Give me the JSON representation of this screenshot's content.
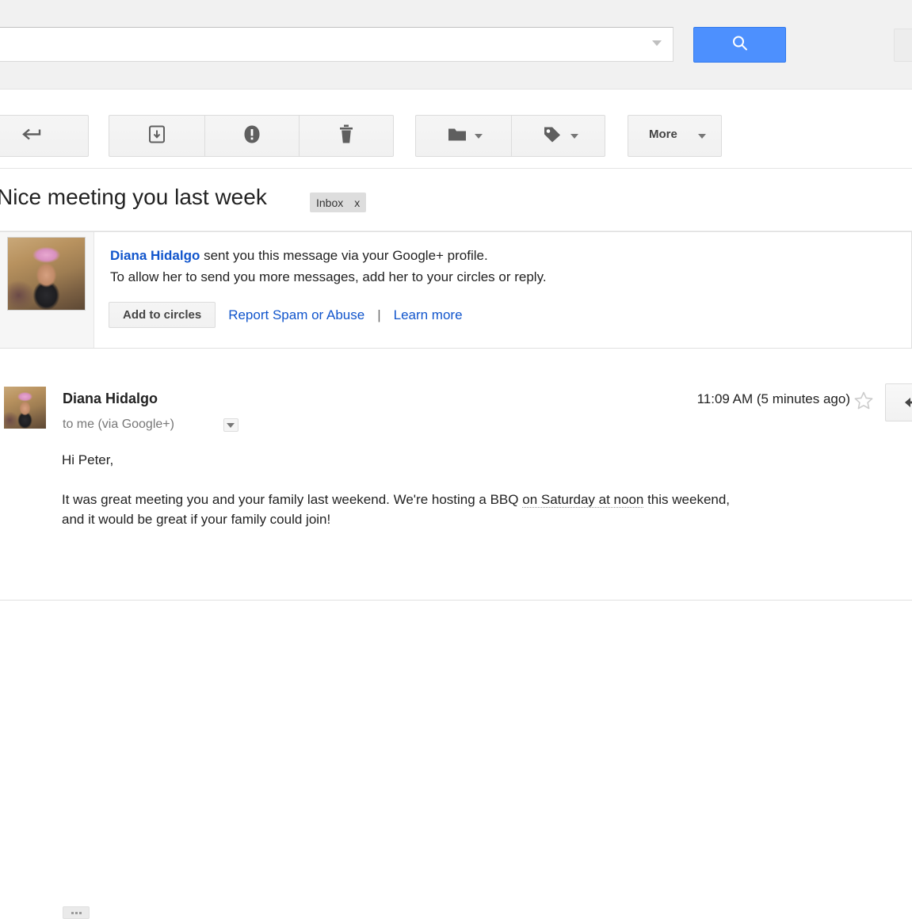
{
  "search": {
    "value": "",
    "placeholder": "",
    "dropdown_icon": "chevron-down-icon",
    "button_icon": "search-icon"
  },
  "toolbar": {
    "back_icon": "back-arrow-icon",
    "archive_icon": "archive-icon",
    "spam_icon": "report-spam-icon",
    "delete_icon": "trash-icon",
    "move_icon": "folder-icon",
    "labels_icon": "tag-icon",
    "more_label": "More",
    "more_caret_icon": "chevron-down-icon"
  },
  "thread": {
    "subject": "Nice meeting you last week",
    "label": "Inbox",
    "label_remove": "x"
  },
  "gplus_banner": {
    "sender_name": "Diana Hidalgo",
    "line1_rest": " sent you this message via your Google+ profile.",
    "line2": "To allow her to send you more messages, add her to your circles or reply.",
    "add_button": "Add to circles",
    "report_link": "Report Spam or Abuse",
    "separator": "|",
    "learn_more_link": "Learn more",
    "avatar_icon": "sender-avatar-photo"
  },
  "message": {
    "sender": "Diana Hidalgo",
    "recipient": "to me (via Google+)",
    "recipient_caret_icon": "chevron-down-icon",
    "timestamp": "11:09 AM (5 minutes ago)",
    "star_icon": "star-outline-icon",
    "reply_icon": "reply-arrow-icon",
    "avatar_icon": "sender-avatar-photo",
    "body": {
      "greeting": "Hi Peter,",
      "para_part1": "It was great meeting you and your family last weekend.  We're hosting a BBQ ",
      "para_smart_date": "on Saturday at noon",
      "para_part2": " this weekend,",
      "para_line2": "and it would be great if your family could join!"
    },
    "trimmed_content_icon": "ellipsis-icon"
  },
  "colors": {
    "accent_blue": "#4d90fe",
    "link_blue": "#1155cc",
    "chrome_gray": "#f1f1f1",
    "border_gray": "#dcdcdc"
  }
}
